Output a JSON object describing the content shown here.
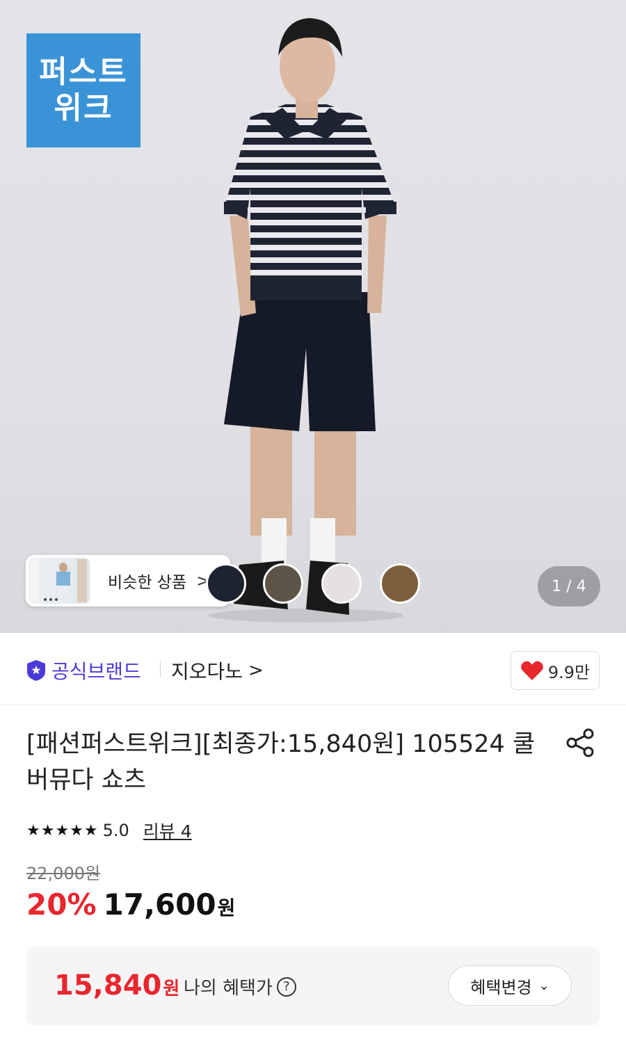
{
  "hero": {
    "brand_badge": [
      "퍼스트",
      "위크"
    ],
    "similar_label": "비슷한 상품",
    "similar_chevron": ">",
    "pager": "1 / 4",
    "swatch_colors": [
      "#1d2330",
      "#5f5448",
      "#e6e0e3",
      "#7c5e3c"
    ]
  },
  "brand": {
    "official_label": "공식브랜드",
    "store_name": "지오다노",
    "store_chevron": ">",
    "likes": "9.9만"
  },
  "product": {
    "title": "[패션퍼스트위크][최종가:15,840원] 105524 쿨 버뮤다 쇼츠",
    "stars": "★★★★★",
    "rating": "5.0",
    "review_link": "리뷰 4",
    "original_price": "22,000원",
    "discount": "20%",
    "sale_price": "17,600",
    "currency": "원"
  },
  "benefit": {
    "price": "15,840",
    "currency": "원",
    "label": "나의 혜택가",
    "help": "?",
    "button_label": "혜택변경",
    "button_chevron": "⌄"
  },
  "colors": {
    "accent_red": "#e8262e",
    "official_purple": "#4b3bd6",
    "badge_blue": "#3a93d6"
  }
}
